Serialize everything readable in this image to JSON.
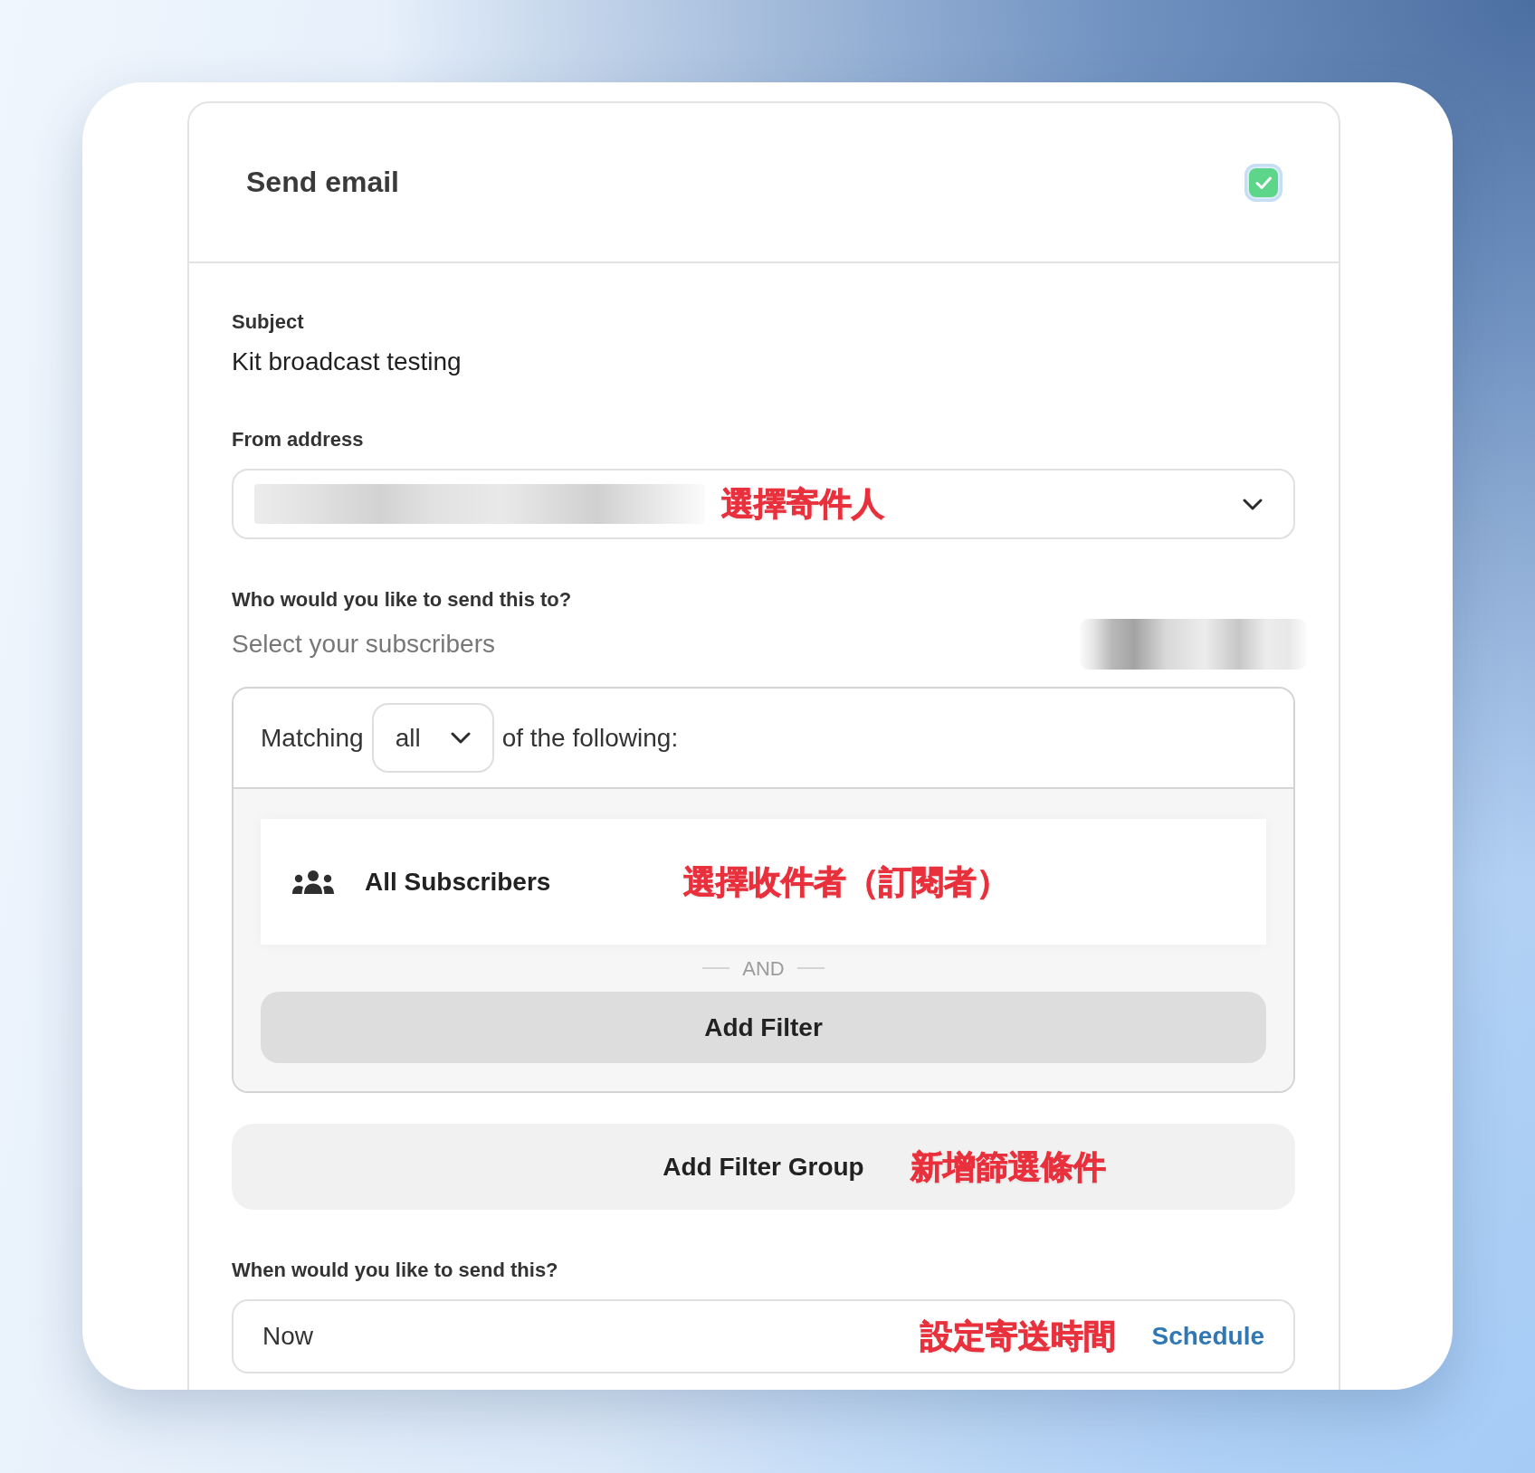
{
  "panel": {
    "title": "Send email",
    "checked": true
  },
  "subject": {
    "label": "Subject",
    "value": "Kit broadcast testing"
  },
  "from_address": {
    "label": "From address",
    "annotation": "選擇寄件人"
  },
  "recipients": {
    "label": "Who would you like to send this to?",
    "hint": "Select your subscribers",
    "filter_group": {
      "matching_prefix": "Matching",
      "match_mode": "all",
      "matching_suffix": "of the following:",
      "filters": [
        {
          "kind": "segment",
          "label": "All Subscribers",
          "annotation": "選擇收件者（訂閱者）"
        }
      ],
      "separator": "AND",
      "add_filter": "Add Filter"
    },
    "add_filter_group": {
      "label": "Add Filter Group",
      "annotation": "新增篩選條件"
    }
  },
  "schedule": {
    "label": "When would you like to send this?",
    "value": "Now",
    "annotation": "設定寄送時間",
    "action": "Schedule"
  }
}
